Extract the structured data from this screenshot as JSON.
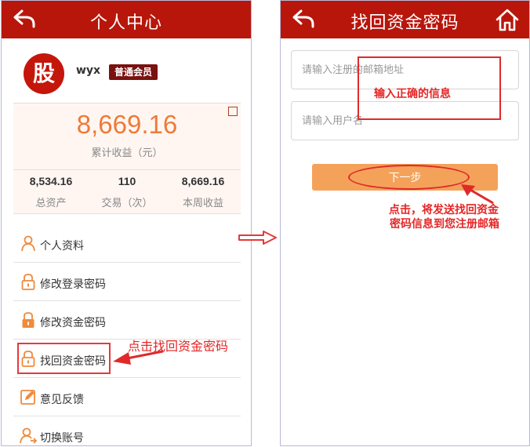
{
  "left_screen": {
    "title": "个人中心",
    "user": {
      "avatar_char": "股",
      "name": "wyx",
      "level_badge": "普通会员"
    },
    "earnings": {
      "total_value": "8,669.16",
      "total_label": "累计收益（元）",
      "stats": [
        {
          "value": "8,534.16",
          "label": "总资产"
        },
        {
          "value": "110",
          "label": "交易（次）"
        },
        {
          "value": "8,669.16",
          "label": "本周收益"
        }
      ]
    },
    "menu": [
      {
        "label": "个人资料",
        "icon": "person-icon"
      },
      {
        "label": "修改登录密码",
        "icon": "lock-open-icon"
      },
      {
        "label": "修改资金密码",
        "icon": "lock-closed-icon"
      },
      {
        "label": "找回资金密码",
        "icon": "lock-open-icon"
      },
      {
        "label": "意见反馈",
        "icon": "edit-icon"
      },
      {
        "label": "切换账号",
        "icon": "switch-user-icon"
      }
    ]
  },
  "right_screen": {
    "title": "找回资金密码",
    "email_placeholder": "请输入注册的邮箱地址",
    "username_placeholder": "请输入用户名",
    "next_button": "下一步"
  },
  "annotations": {
    "left_hint": "点击找回资金密码",
    "input_hint": "输入正确的信息",
    "next_hint_line1": "点击，将发送找回资金",
    "next_hint_line2": "密码信息到您注册邮箱"
  },
  "colors": {
    "header_red": "#b8160b",
    "accent_orange": "#ef7a36",
    "button_orange": "#f4a25a",
    "annotation_red": "#e02a2a"
  }
}
